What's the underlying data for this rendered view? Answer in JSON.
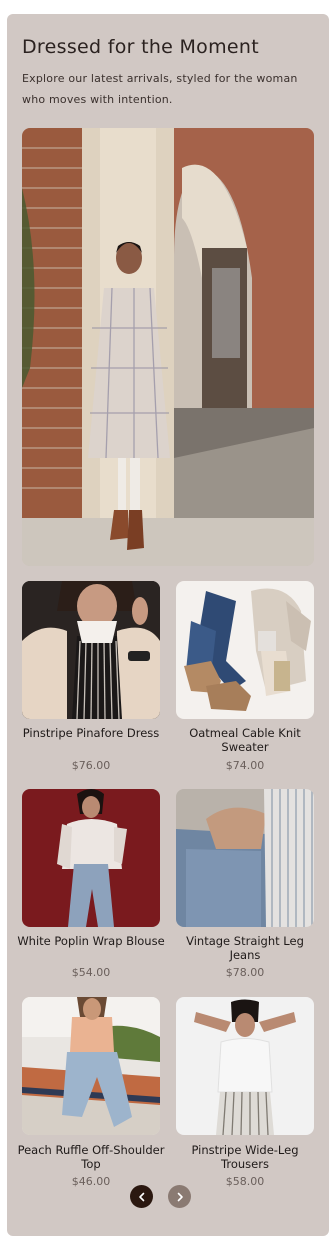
{
  "section": {
    "title": "Dressed for the Moment",
    "subtitle": "Explore our latest arrivals, styled for the woman who moves with intention."
  },
  "products": [
    {
      "name": "Pinstripe Pinafore Dress",
      "price": "$76.00"
    },
    {
      "name": "Oatmeal Cable Knit Sweater",
      "price": "$74.00"
    },
    {
      "name": "White Poplin Wrap Blouse",
      "price": "$54.00"
    },
    {
      "name": "Vintage Straight Leg Jeans",
      "price": "$78.00"
    },
    {
      "name": "Peach Ruffle Off-Shoulder Top",
      "price": "$46.00"
    },
    {
      "name": "Pinstripe Wide-Leg Trousers",
      "price": "$58.00"
    }
  ],
  "carousel": {
    "prev_icon": "chevron-left-icon",
    "next_icon": "chevron-right-icon"
  },
  "colors": {
    "card_background": "#d1c8c4",
    "prev_button": "#2b1810",
    "next_button": "#8a7a72"
  }
}
